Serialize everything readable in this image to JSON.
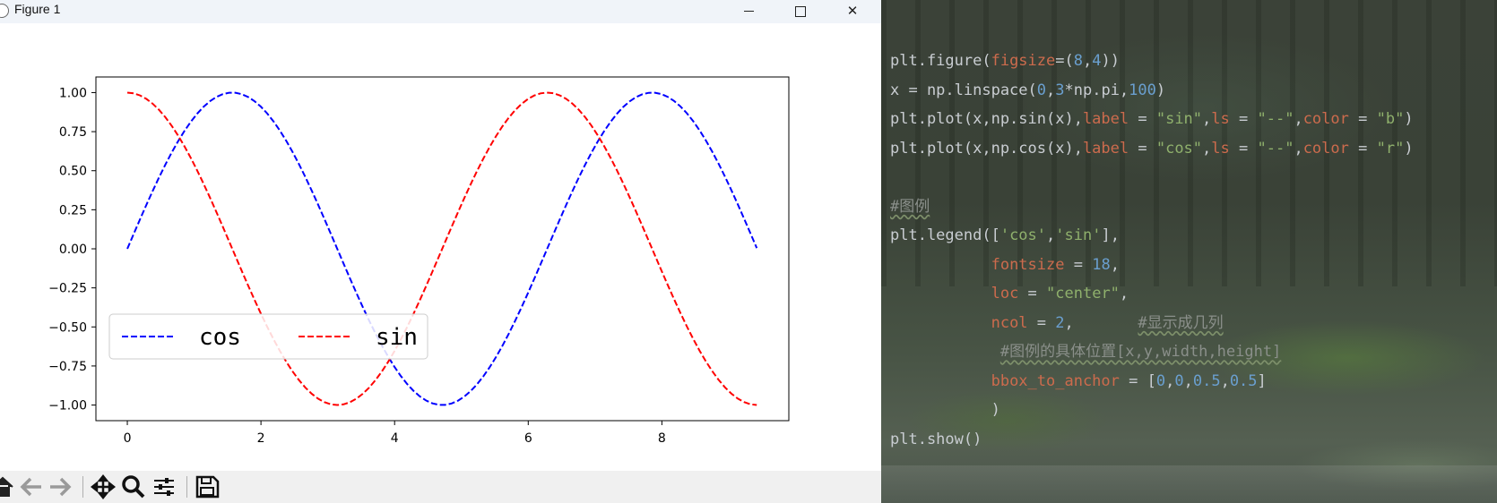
{
  "window": {
    "title": "Figure 1",
    "minimize_label": "",
    "maximize_label": "",
    "close_label": "✕"
  },
  "toolbar": {
    "icons": [
      "home-icon",
      "back-arrow-icon",
      "forward-arrow-icon",
      "pan-move-icon",
      "zoom-magnifier-icon",
      "configure-subplots-icon",
      "save-floppy-icon"
    ]
  },
  "chart_data": {
    "type": "line",
    "title": "",
    "xlabel": "",
    "ylabel": "",
    "xlim": [
      -0.47,
      9.9
    ],
    "ylim": [
      -1.1,
      1.1
    ],
    "xticks": [
      0,
      2,
      4,
      6,
      8
    ],
    "yticks": [
      1.0,
      0.75,
      0.5,
      0.25,
      0.0,
      -0.25,
      -0.5,
      -0.75,
      -1.0
    ],
    "xtick_labels": [
      "0",
      "2",
      "4",
      "6",
      "8"
    ],
    "ytick_labels": [
      "1.00",
      "0.75",
      "0.50",
      "0.25",
      "0.00",
      "−0.25",
      "−0.50",
      "−0.75",
      "−1.00"
    ],
    "x_range": [
      0,
      9.42
    ],
    "n_points": 100,
    "series": [
      {
        "function": "sin(x)",
        "color": "#0000ff",
        "linestyle": "--"
      },
      {
        "function": "cos(x)",
        "color": "#ff0000",
        "linestyle": "--"
      }
    ],
    "legend": {
      "entries": [
        {
          "label": "cos",
          "color": "#0000ff"
        },
        {
          "label": "sin",
          "color": "#ff0000"
        }
      ],
      "placement": "center-left",
      "columns": 2
    },
    "grid": false
  },
  "code": {
    "lines": [
      [
        [
          "plt.figure(",
          "t-fn"
        ],
        [
          "figsize",
          "t-kw"
        ],
        [
          "=(",
          "t-p"
        ],
        [
          "8",
          "t-num"
        ],
        [
          ",",
          "t-p"
        ],
        [
          "4",
          "t-num"
        ],
        [
          "))",
          "t-p"
        ]
      ],
      [
        [
          "x = np.linspace(",
          "t-fn"
        ],
        [
          "0",
          "t-num"
        ],
        [
          ",",
          "t-p"
        ],
        [
          "3",
          "t-num"
        ],
        [
          "*np.pi,",
          "t-p"
        ],
        [
          "100",
          "t-num"
        ],
        [
          ")",
          "t-p"
        ]
      ],
      [
        [
          "plt.plot(x,np.sin(x),",
          "t-fn"
        ],
        [
          "label",
          "t-kw"
        ],
        [
          " = ",
          "t-p"
        ],
        [
          "\"sin\"",
          "t-str"
        ],
        [
          ",",
          "t-p"
        ],
        [
          "ls",
          "t-kw"
        ],
        [
          " = ",
          "t-p"
        ],
        [
          "\"--\"",
          "t-str"
        ],
        [
          ",",
          "t-p"
        ],
        [
          "color",
          "t-kw"
        ],
        [
          " = ",
          "t-p"
        ],
        [
          "\"b\"",
          "t-str"
        ],
        [
          ")",
          "t-p"
        ]
      ],
      [
        [
          "plt.plot(x,np.cos(x),",
          "t-fn"
        ],
        [
          "label",
          "t-kw"
        ],
        [
          " = ",
          "t-p"
        ],
        [
          "\"cos\"",
          "t-str"
        ],
        [
          ",",
          "t-p"
        ],
        [
          "ls",
          "t-kw"
        ],
        [
          " = ",
          "t-p"
        ],
        [
          "\"--\"",
          "t-str"
        ],
        [
          ",",
          "t-p"
        ],
        [
          "color",
          "t-kw"
        ],
        [
          " = ",
          "t-p"
        ],
        [
          "\"r\"",
          "t-str"
        ],
        [
          ")",
          "t-p"
        ]
      ],
      [],
      [
        [
          "#图例",
          "t-cmt"
        ]
      ],
      [
        [
          "plt.legend([",
          "t-fn"
        ],
        [
          "'cos'",
          "t-str"
        ],
        [
          ",",
          "t-p"
        ],
        [
          "'sin'",
          "t-str"
        ],
        [
          "],",
          "t-p"
        ]
      ],
      [
        [
          "           ",
          "t-p"
        ],
        [
          "fontsize",
          "t-kw"
        ],
        [
          " = ",
          "t-p"
        ],
        [
          "18",
          "t-num"
        ],
        [
          ",",
          "t-p"
        ]
      ],
      [
        [
          "           ",
          "t-p"
        ],
        [
          "loc",
          "t-kw"
        ],
        [
          " = ",
          "t-p"
        ],
        [
          "\"center\"",
          "t-str"
        ],
        [
          ",",
          "t-p"
        ],
        [
          ""
        ]
      ],
      [
        [
          "           ",
          "t-p"
        ],
        [
          "ncol",
          "t-kw"
        ],
        [
          " = ",
          "t-p"
        ],
        [
          "2",
          "t-num"
        ],
        [
          ",       ",
          "t-p"
        ],
        [
          "#显示成几列",
          "t-cmt"
        ]
      ],
      [
        [
          "            ",
          "t-p"
        ],
        [
          "#图例的具体位置[x,y,width,height]",
          "t-cmt"
        ]
      ],
      [
        [
          "           ",
          "t-p"
        ],
        [
          "bbox_to_anchor",
          "t-kw"
        ],
        [
          " = [",
          "t-p"
        ],
        [
          "0",
          "t-num"
        ],
        [
          ",",
          "t-p"
        ],
        [
          "0",
          "t-num"
        ],
        [
          ",",
          "t-p"
        ],
        [
          "0.5",
          "t-num"
        ],
        [
          ",",
          "t-p"
        ],
        [
          "0.5",
          "t-num"
        ],
        [
          "]",
          "t-p"
        ]
      ],
      [
        [
          "           )",
          "t-p"
        ]
      ],
      [
        [
          "plt.show()",
          "t-fn"
        ]
      ]
    ]
  }
}
